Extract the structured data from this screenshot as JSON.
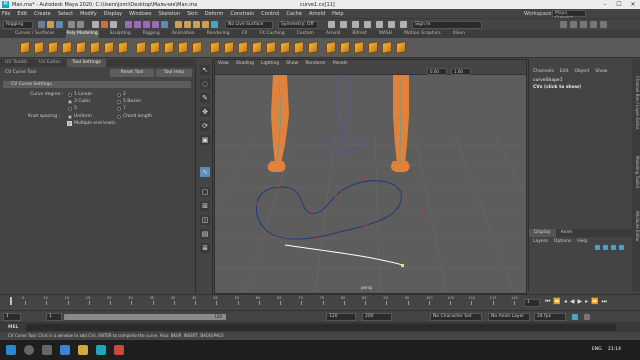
{
  "window": {
    "title": "Man.ma* - Autodesk Maya 2020: C:\\Users\\jomi\\Desktop\\Мальчик\\Man.ma",
    "center_title": "curve1.cv[11]",
    "logo": "M"
  },
  "menubar": {
    "items": [
      "File",
      "Edit",
      "Create",
      "Select",
      "Modify",
      "Display",
      "Windows",
      "Skeleton",
      "Skin",
      "Deform",
      "Constrain",
      "Control",
      "Cache",
      "Arnold",
      "Help"
    ],
    "workspace_label": "Workspace :",
    "workspace_value": "Maya Classic*"
  },
  "statusline": {
    "mode": "Rigging",
    "live_surface": "No Live Surface",
    "symmetry": "Symmetry: Off",
    "sign_in": "Sign In"
  },
  "shelf": {
    "tabs": [
      "Curves / Surfaces",
      "Poly Modeling",
      "Sculpting",
      "Rigging",
      "Animation",
      "Rendering",
      "FX",
      "FX Caching",
      "Custom",
      "Arnold",
      "Bifrost",
      "MASH",
      "Motion Graphics",
      "XGen"
    ],
    "active_tab": 1
  },
  "tool_settings": {
    "tabs": [
      "UV Toolkit",
      "UV Editor",
      "Tool Settings"
    ],
    "tool_name": "CV Curve Tool",
    "reset_label": "Reset Tool",
    "help_label": "Tool Help",
    "section_title": "CV Curve Settings",
    "curve_degree_label": "Curve degree :",
    "degrees": [
      "1 Linear",
      "2",
      "3 Cubic",
      "5 Bezier",
      "5",
      "7"
    ],
    "knot_spacing_label": "Knot spacing :",
    "knot_options": [
      "Uniform",
      "Chord length"
    ],
    "multiple_end_knots": "Multiple end knots"
  },
  "viewport": {
    "menu": [
      "View",
      "Shading",
      "Lighting",
      "Show",
      "Renderer",
      "Panels"
    ],
    "camera_label": "persp",
    "field_1": "0.00",
    "field_2": "1.00"
  },
  "channel_box": {
    "tabs": [
      "Channels",
      "Edit",
      "Object",
      "Show"
    ],
    "shape_name": "curveShape1",
    "cvs_label": "CVs (click to show)",
    "layer_tabs": [
      "Display",
      "Anim"
    ],
    "layer_menu": [
      "Layers",
      "Options",
      "Help"
    ]
  },
  "side_tabs": [
    "Channel Box / Layer Editor",
    "Modeling Toolkit",
    "Attribute Editor"
  ],
  "timeline": {
    "ticks": [
      "5",
      "10",
      "15",
      "20",
      "25",
      "30",
      "35",
      "40",
      "45",
      "50",
      "55",
      "60",
      "65",
      "70",
      "75",
      "80",
      "85",
      "90",
      "95",
      "100",
      "105",
      "110",
      "115",
      "120"
    ],
    "current_frame": "1",
    "start": "1",
    "range_start": "1",
    "range_end": "120",
    "end": "120",
    "playback_end": "200",
    "character_set": "No Character Set",
    "anim_layer": "No Anim Layer",
    "fps": "24 fps"
  },
  "mel": {
    "label": "MEL",
    "help_text": "CV Curve Tool: Click in a window to add CVs. ENTER to complete the curve. Also: BKSP, INSERT, BACKSPACE"
  },
  "taskbar": {
    "lang": "ENG",
    "time": "21:14"
  }
}
